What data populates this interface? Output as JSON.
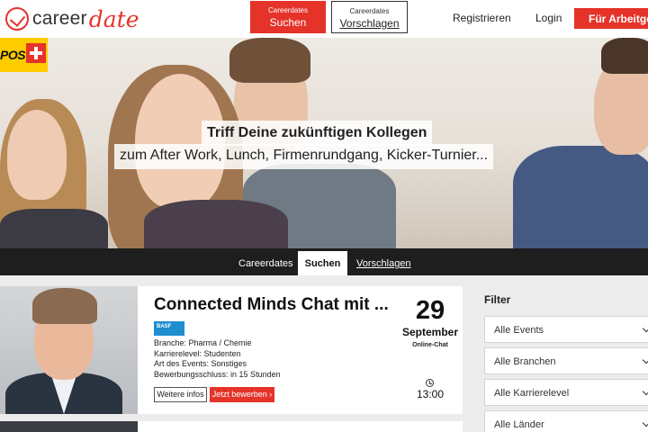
{
  "header": {
    "logo_text": "career",
    "logo_script": "date",
    "suchen_small": "Careerdates",
    "suchen_label": "Suchen",
    "vorschlagen_small": "Careerdates",
    "vorschlagen_label": "Vorschlagen",
    "registrieren": "Registrieren",
    "login": "Login",
    "arbeitgeber": "Für Arbeitgeber"
  },
  "hero": {
    "sponsor_logo_text": "POST",
    "title": "Triff Deine zukünftigen Kollegen",
    "subtitle": "zum After Work, Lunch, Firmenrundgang, Kicker-Turnier..."
  },
  "tabs": {
    "label": "Careerdates",
    "active": "Suchen",
    "other": "Vorschlagen"
  },
  "event": {
    "title": "Connected Minds Chat mit ...",
    "company_logo": "BASF",
    "info": [
      "Branche: Pharma / Chemie",
      "Karrierelevel: Studenten",
      "Art des Events: Sonstiges",
      "Bewerbungsschluss: in 15 Stunden"
    ],
    "more_button": "Weitere infos",
    "apply_button": "Jetzt bewerben ›",
    "day": "29",
    "month": "September",
    "type": "Online-Chat",
    "time": "13:00"
  },
  "filter": {
    "title": "Filter",
    "selects": [
      "Alle Events",
      "Alle Branchen",
      "Alle Karrierelevel",
      "Alle Länder"
    ]
  },
  "colors": {
    "accent": "#e5332a",
    "dark_bar": "#1e1e1e",
    "post_yellow": "#ffcc00",
    "basf_blue": "#1f8ecf"
  }
}
